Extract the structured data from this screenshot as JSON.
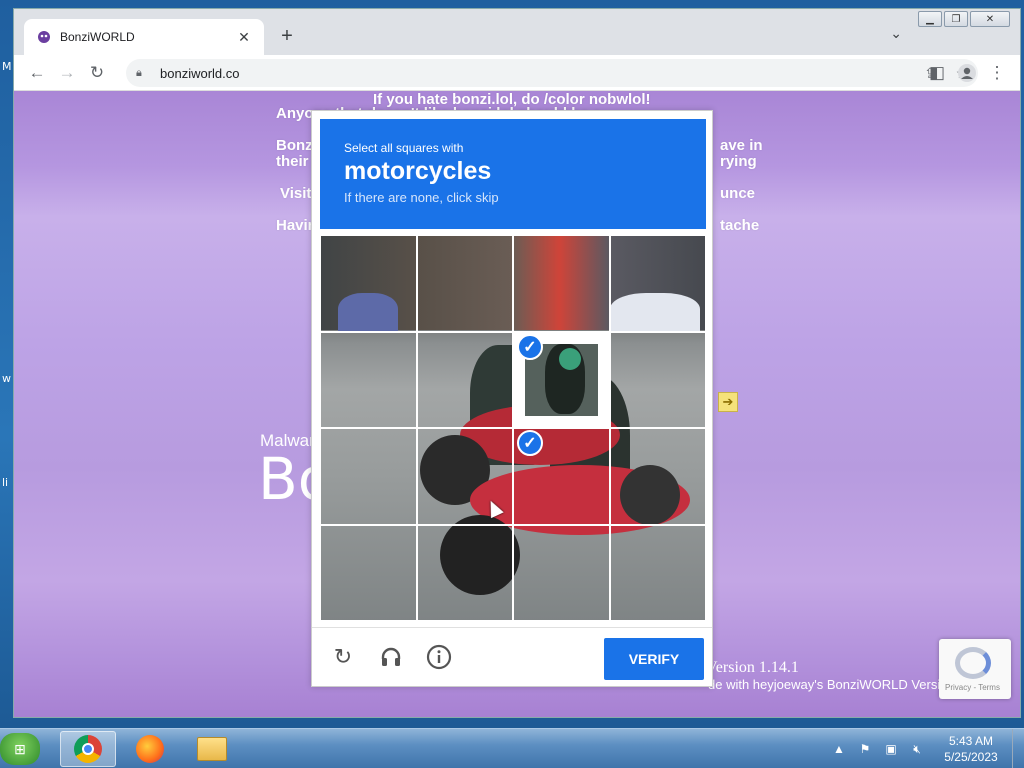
{
  "window": {
    "tab_title": "BonziWORLD",
    "url": "bonziworld.co"
  },
  "page": {
    "lines": [
      "If you hate bonzi.lol, do /color nobwlol!",
      "Anyone that doesn't like bonzi.lol should be a",
      "Bonzi",
      "ave in",
      "their",
      "rying",
      "Visit",
      "unce",
      "Havin",
      "tache"
    ],
    "malware_label": "Malwar",
    "big_title": "Bo",
    "version": "Version 1.14.1",
    "credit": "de with heyjoeway's BonziWORLD Versi",
    "recaptcha_terms": "Privacy - Terms"
  },
  "captcha": {
    "instruction": "Select all squares with",
    "object": "motorcycles",
    "hint": "If there are none, click skip",
    "verify_label": "VERIFY",
    "selected_cells": [
      6,
      10
    ]
  },
  "taskbar": {
    "time": "5:43 AM",
    "date": "5/25/2023"
  },
  "colors": {
    "accent": "#1a73e8",
    "page_bg": "#b596e0"
  }
}
